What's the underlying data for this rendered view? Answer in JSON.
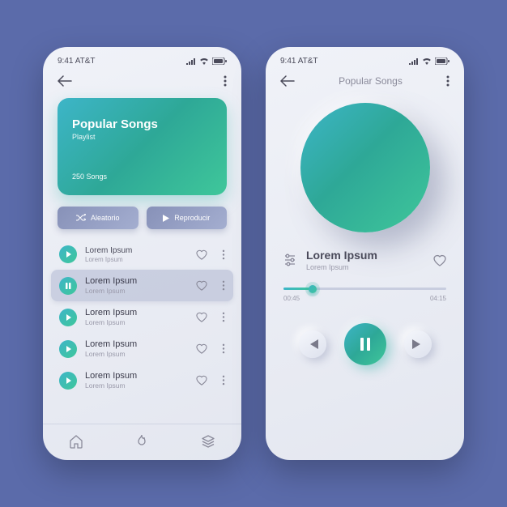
{
  "status": {
    "time": "9:41",
    "carrier": "AT&T"
  },
  "screen1": {
    "hero": {
      "title": "Popular Songs",
      "subtitle": "Playlist",
      "count": "250 Songs"
    },
    "pills": {
      "shuffle": "Aleatorio",
      "play": "Reproducir"
    },
    "songs": [
      {
        "title": "Lorem Ipsum",
        "sub": "Lorem Ipsum",
        "playing": false
      },
      {
        "title": "Lorem Ipsum",
        "sub": "Lorem Ipsum",
        "playing": true
      },
      {
        "title": "Lorem Ipsum",
        "sub": "Lorem Ipsum",
        "playing": false
      },
      {
        "title": "Lorem Ipsum",
        "sub": "Lorem Ipsum",
        "playing": false
      },
      {
        "title": "Lorem Ipsum",
        "sub": "Lorem Ipsum",
        "playing": false
      }
    ]
  },
  "screen2": {
    "navTitle": "Popular Songs",
    "track": {
      "title": "Lorem Ipsum",
      "sub": "Lorem Ipsum"
    },
    "time": {
      "elapsed": "00:45",
      "total": "04:15"
    },
    "progressPercent": 18
  }
}
